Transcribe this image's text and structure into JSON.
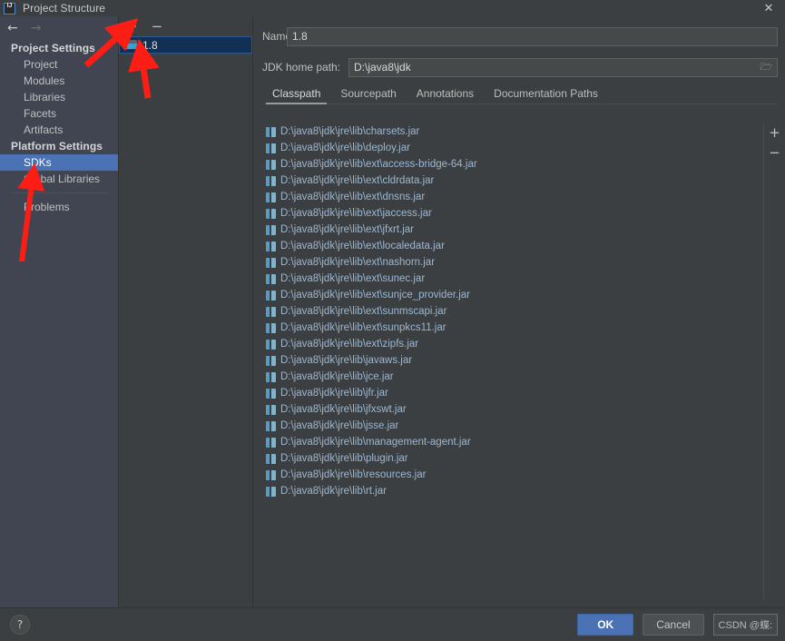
{
  "window": {
    "title": "Project Structure",
    "app_icon": "intellij-idea-icon",
    "close_label": "✕"
  },
  "sidebar": {
    "nav": {
      "back": "←",
      "forward": "→"
    },
    "groups": [
      {
        "label": "Project Settings",
        "items": [
          {
            "label": "Project",
            "selected": false
          },
          {
            "label": "Modules",
            "selected": false
          },
          {
            "label": "Libraries",
            "selected": false
          },
          {
            "label": "Facets",
            "selected": false
          },
          {
            "label": "Artifacts",
            "selected": false
          }
        ]
      },
      {
        "label": "Platform Settings",
        "items": [
          {
            "label": "SDKs",
            "selected": true
          },
          {
            "label": "Global Libraries",
            "selected": false
          }
        ]
      }
    ],
    "footer_items": [
      {
        "label": "Problems",
        "selected": false
      }
    ]
  },
  "sdk_panel": {
    "toolbar": {
      "add": "+",
      "remove": "−"
    },
    "items": [
      {
        "label": "1.8",
        "icon": "folder-icon",
        "selected": true
      }
    ]
  },
  "detail": {
    "name_field": {
      "label": "Name:",
      "value": "1.8"
    },
    "home_field": {
      "label": "JDK home path:",
      "value": "D:\\java8\\jdk",
      "browse_icon": "folder-browse-icon"
    },
    "tabs": [
      {
        "label": "Classpath",
        "active": true
      },
      {
        "label": "Sourcepath",
        "active": false
      },
      {
        "label": "Annotations",
        "active": false
      },
      {
        "label": "Documentation Paths",
        "active": false
      }
    ],
    "classpath_toolbar": {
      "add": "+",
      "remove": "−"
    },
    "classpath": [
      "D:\\java8\\jdk\\jre\\lib\\charsets.jar",
      "D:\\java8\\jdk\\jre\\lib\\deploy.jar",
      "D:\\java8\\jdk\\jre\\lib\\ext\\access-bridge-64.jar",
      "D:\\java8\\jdk\\jre\\lib\\ext\\cldrdata.jar",
      "D:\\java8\\jdk\\jre\\lib\\ext\\dnsns.jar",
      "D:\\java8\\jdk\\jre\\lib\\ext\\jaccess.jar",
      "D:\\java8\\jdk\\jre\\lib\\ext\\jfxrt.jar",
      "D:\\java8\\jdk\\jre\\lib\\ext\\localedata.jar",
      "D:\\java8\\jdk\\jre\\lib\\ext\\nashorn.jar",
      "D:\\java8\\jdk\\jre\\lib\\ext\\sunec.jar",
      "D:\\java8\\jdk\\jre\\lib\\ext\\sunjce_provider.jar",
      "D:\\java8\\jdk\\jre\\lib\\ext\\sunmscapi.jar",
      "D:\\java8\\jdk\\jre\\lib\\ext\\sunpkcs11.jar",
      "D:\\java8\\jdk\\jre\\lib\\ext\\zipfs.jar",
      "D:\\java8\\jdk\\jre\\lib\\javaws.jar",
      "D:\\java8\\jdk\\jre\\lib\\jce.jar",
      "D:\\java8\\jdk\\jre\\lib\\jfr.jar",
      "D:\\java8\\jdk\\jre\\lib\\jfxswt.jar",
      "D:\\java8\\jdk\\jre\\lib\\jsse.jar",
      "D:\\java8\\jdk\\jre\\lib\\management-agent.jar",
      "D:\\java8\\jdk\\jre\\lib\\plugin.jar",
      "D:\\java8\\jdk\\jre\\lib\\resources.jar",
      "D:\\java8\\jdk\\jre\\lib\\rt.jar"
    ]
  },
  "footer": {
    "help_label": "?",
    "ok_label": "OK",
    "cancel_label": "Cancel",
    "watermark": "CSDN @蝶:"
  },
  "annotations": {
    "arrow_color": "#fc1d15",
    "arrows": [
      {
        "name": "arrow-to-add-sdk-button"
      },
      {
        "name": "arrow-to-sdk-1-8-item"
      },
      {
        "name": "arrow-to-sdks-sidebar-item"
      }
    ]
  },
  "colors": {
    "background": "#3c3f41",
    "sidebar_background": "#414552",
    "selection_blue": "#4a72b5",
    "tree_selection": "#123054",
    "path_text": "#9db7cf",
    "accent": "#4a88c7"
  }
}
